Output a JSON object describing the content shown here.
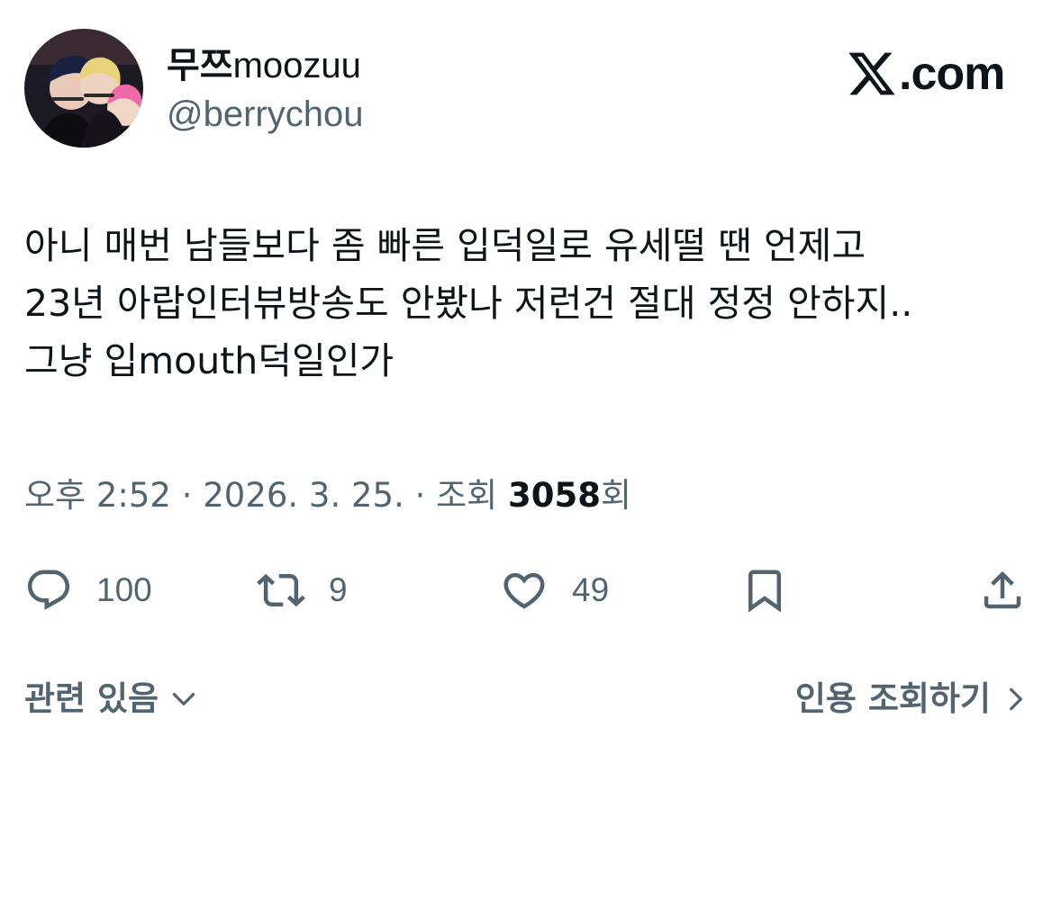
{
  "author": {
    "display_name_hangul": "무쯔",
    "display_name_latin": "moozuu",
    "handle": "@berrychou",
    "avatar_icon": "avatar-illustration"
  },
  "brand": {
    "logo_icon": "x-logo-icon",
    "suffix": ".com"
  },
  "tweet": {
    "lines": [
      "아니 매번 남들보다 좀 빠른 입덕일로 유세떨 땐 언제고",
      "23년 아랍인터뷰방송도 안봤나 저런건 절대 정정 안하지..",
      "그냥 입mouth덕일인가"
    ]
  },
  "meta": {
    "time": "오후 2:52",
    "date": "2026. 3. 25.",
    "views_label": "조회",
    "views_count": "3058",
    "views_suffix": "회",
    "separator": "·"
  },
  "actions": {
    "reply_count": "100",
    "repost_count": "9",
    "like_count": "49"
  },
  "footer": {
    "related_label": "관련 있음",
    "quotes_label": "인용 조회하기"
  },
  "colors": {
    "text": "#0f1419",
    "secondary": "#536471",
    "background": "#ffffff"
  }
}
